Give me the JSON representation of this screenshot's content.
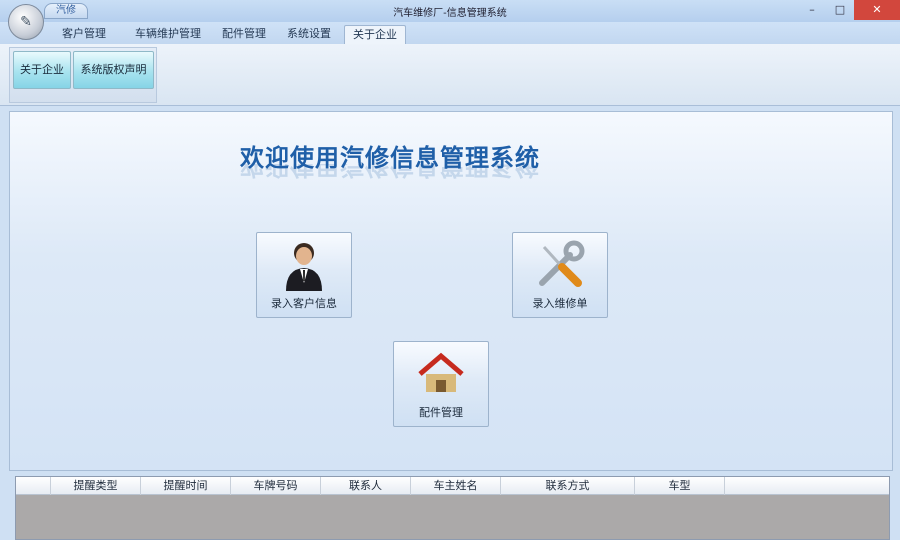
{
  "window": {
    "title": "汽车维修厂-信息管理系统",
    "quick_access": "汽修",
    "minimize": "–",
    "maximize": "□",
    "close": "✕"
  },
  "tabs": [
    {
      "label": "客户管理"
    },
    {
      "label": "车辆维护管理"
    },
    {
      "label": "配件管理"
    },
    {
      "label": "系统设置"
    },
    {
      "label": "关于企业",
      "active": true
    }
  ],
  "ribbon": {
    "buttons": [
      {
        "label": "关于企业"
      },
      {
        "label": "系统版权声明"
      }
    ]
  },
  "main": {
    "welcome": "欢迎使用汽修信息管理系统",
    "buttons": [
      {
        "label": "录入客户信息",
        "icon": "person-icon"
      },
      {
        "label": "录入维修单",
        "icon": "tools-icon"
      },
      {
        "label": "配件管理",
        "icon": "house-icon"
      }
    ]
  },
  "grid": {
    "columns": [
      "提醒类型",
      "提醒时间",
      "车牌号码",
      "联系人",
      "车主姓名",
      "联系方式",
      "车型"
    ]
  }
}
